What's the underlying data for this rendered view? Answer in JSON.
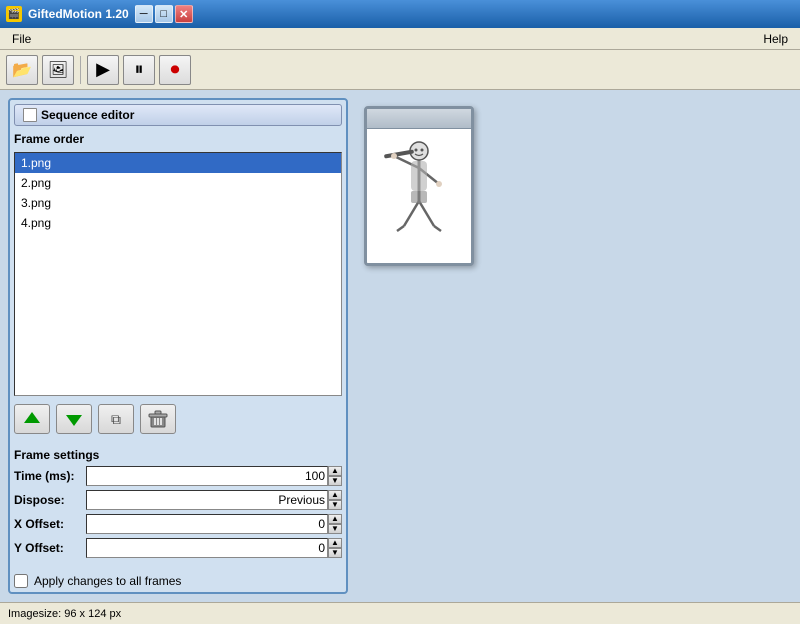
{
  "titlebar": {
    "icon": "🎬",
    "title": "GiftedMotion 1.20",
    "minimize_label": "─",
    "maximize_label": "□",
    "close_label": "✕"
  },
  "menubar": {
    "items": [
      {
        "id": "file",
        "label": "File"
      },
      {
        "id": "help",
        "label": "Help"
      }
    ]
  },
  "toolbar": {
    "buttons": [
      {
        "id": "open",
        "icon": "📂",
        "title": "Open"
      },
      {
        "id": "image",
        "icon": "🖼",
        "title": "Add Image"
      },
      {
        "id": "play",
        "icon": "▶",
        "title": "Play"
      },
      {
        "id": "pause",
        "icon": "⏸",
        "title": "Pause"
      },
      {
        "id": "record",
        "icon": "⏺",
        "title": "Record",
        "color": "#cc0000"
      }
    ]
  },
  "sequence_editor": {
    "title": "Sequence editor",
    "frame_order_label": "Frame order",
    "frames": [
      {
        "name": "1.png",
        "selected": true
      },
      {
        "name": "2.png",
        "selected": false
      },
      {
        "name": "3.png",
        "selected": false
      },
      {
        "name": "4.png",
        "selected": false
      }
    ],
    "buttons": {
      "up_label": "▲",
      "down_label": "▼",
      "copy_label": "⧉",
      "delete_label": "🗑"
    },
    "frame_settings_label": "Frame settings",
    "settings": {
      "time_label": "Time (ms):",
      "time_value": "100",
      "dispose_label": "Dispose:",
      "dispose_value": "Previous",
      "xoffset_label": "X Offset:",
      "xoffset_value": "0",
      "yoffset_label": "Y Offset:",
      "yoffset_value": "0"
    },
    "apply_label": "Apply changes to all frames"
  },
  "statusbar": {
    "imagesize_label": "Imagesize: 96 x 124 px"
  }
}
